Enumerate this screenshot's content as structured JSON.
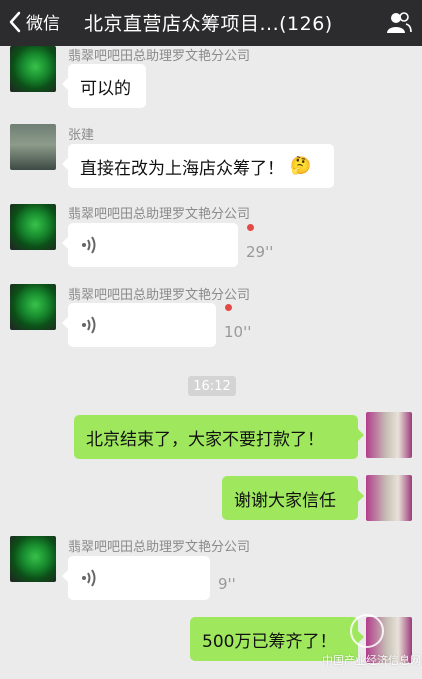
{
  "header": {
    "back_label": "微信",
    "title": "北京直营店众筹项目...(126)"
  },
  "messages": {
    "m1": {
      "sender": "翡翠吧吧田总助理罗文艳分公司",
      "text": "可以的"
    },
    "m2": {
      "sender": "张建",
      "text": "直接在改为上海店众筹了！",
      "emoji": "🤔"
    },
    "m3": {
      "sender": "翡翠吧吧田总助理罗文艳分公司",
      "duration": "29''"
    },
    "m4": {
      "sender": "翡翠吧吧田总助理罗文艳分公司",
      "duration": "10''"
    },
    "time": "16:12",
    "m5": {
      "text": "北京结束了，大家不要打款了！"
    },
    "m6": {
      "text": "谢谢大家信任"
    },
    "m7": {
      "sender": "翡翠吧吧田总助理罗文艳分公司",
      "duration": "9''"
    },
    "m8": {
      "text": "500万已筹齐了！"
    }
  },
  "watermark": "中国产业经济信息网",
  "colors": {
    "header_bg": "#2c2c2e",
    "chat_bg": "#ebebeb",
    "my_bubble": "#9fe85e",
    "unread_dot": "#e24a43"
  }
}
